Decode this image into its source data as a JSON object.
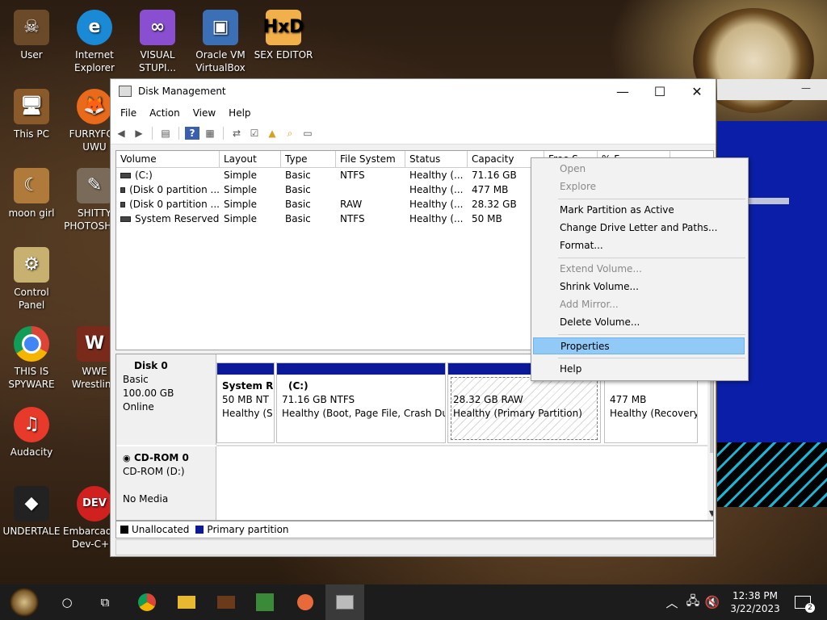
{
  "desktop": {
    "icons": [
      {
        "label": "User",
        "icon": "user-skull-icon",
        "color": "#6b4a2a"
      },
      {
        "label": "Internet Explorer",
        "icon": "edge-icon",
        "color": "#1b8ad6"
      },
      {
        "label": "VISUAL STUPI...",
        "icon": "visual-studio-icon",
        "color": "#8a4fd0"
      },
      {
        "label": "Oracle VM VirtualBox",
        "icon": "virtualbox-icon",
        "color": "#3b6fb6"
      },
      {
        "label": "SEX EDITOR",
        "icon": "hex-editor-icon",
        "color": "#f2b04a"
      },
      {
        "label": "This PC",
        "icon": "this-pc-icon",
        "color": "#8a5a2a"
      },
      {
        "label": "FURRYFOX UWU",
        "icon": "firefox-icon",
        "color": "#e86a1a"
      },
      {
        "label": "moon girl",
        "icon": "moon-girl-icon",
        "color": "#b07a3a"
      },
      {
        "label": "SHITTY PHOTOSHOP",
        "icon": "gimp-icon",
        "color": "#7a6a5a"
      },
      {
        "label": "Control Panel",
        "icon": "control-panel-icon",
        "color": "#c8b070"
      },
      {
        "label": "THIS IS SPYWARE",
        "icon": "chrome-icon",
        "color": "#2a8a3a"
      },
      {
        "label": "WWE Wrestling",
        "icon": "wwe-icon",
        "color": "#7a2a1a"
      },
      {
        "label": "Audacity",
        "icon": "audacity-icon",
        "color": "#e83a2a"
      },
      {
        "label": "UNDERTALE",
        "icon": "unity-icon",
        "color": "#222222"
      },
      {
        "label": "Embarcadero Dev-C++",
        "icon": "devcpp-icon",
        "color": "#d02020"
      }
    ]
  },
  "window": {
    "title": "Disk Management",
    "controls": {
      "minimize": "—",
      "maximize": "☐",
      "close": "✕"
    },
    "menu": [
      "File",
      "Action",
      "View",
      "Help"
    ]
  },
  "volumes": {
    "columns": [
      "Volume",
      "Layout",
      "Type",
      "File System",
      "Status",
      "Capacity",
      "Free S...",
      "% F..."
    ],
    "rows": [
      {
        "volume": "(C:)",
        "layout": "Simple",
        "type": "Basic",
        "fs": "NTFS",
        "status": "Healthy (...",
        "capacity": "71.16 GB"
      },
      {
        "volume": "(Disk 0 partition ...",
        "layout": "Simple",
        "type": "Basic",
        "fs": "",
        "status": "Healthy (...",
        "capacity": "477 MB"
      },
      {
        "volume": "(Disk 0 partition ...",
        "layout": "Simple",
        "type": "Basic",
        "fs": "RAW",
        "status": "Healthy (...",
        "capacity": "28.32 GB"
      },
      {
        "volume": "System Reserved",
        "layout": "Simple",
        "type": "Basic",
        "fs": "NTFS",
        "status": "Healthy (...",
        "capacity": "50 MB"
      }
    ]
  },
  "disks": {
    "disk0": {
      "name": "Disk 0",
      "type": "Basic",
      "size": "100.00 GB",
      "state": "Online",
      "partitions": [
        {
          "title": "System Re",
          "line1": "50 MB NT",
          "line2": "Healthy (S"
        },
        {
          "title": "(C:)",
          "line1": "71.16 GB NTFS",
          "line2": "Healthy (Boot, Page File, Crash Dun"
        },
        {
          "title": "",
          "line1": "28.32 GB RAW",
          "line2": "Healthy (Primary Partition)"
        },
        {
          "title": "",
          "line1": "477 MB",
          "line2": "Healthy (Recovery"
        }
      ]
    },
    "cdrom": {
      "name": "CD-ROM 0",
      "drive": "CD-ROM (D:)",
      "media": "No Media"
    }
  },
  "legend": {
    "unallocated": "Unallocated",
    "unallocated_color": "#000000",
    "primary": "Primary partition",
    "primary_color": "#0c1a9a"
  },
  "context_menu": {
    "items": [
      {
        "label": "Open",
        "enabled": false
      },
      {
        "label": "Explore",
        "enabled": false
      },
      {
        "label": "Mark Partition as Active",
        "enabled": true
      },
      {
        "label": "Change Drive Letter and Paths...",
        "enabled": true
      },
      {
        "label": "Format...",
        "enabled": true
      },
      {
        "label": "Extend Volume...",
        "enabled": false
      },
      {
        "label": "Shrink Volume...",
        "enabled": true
      },
      {
        "label": "Add Mirror...",
        "enabled": false
      },
      {
        "label": "Delete Volume...",
        "enabled": true
      },
      {
        "label": "Properties",
        "enabled": true,
        "highlighted": true
      },
      {
        "label": "Help",
        "enabled": true
      }
    ]
  },
  "taskbar": {
    "time": "12:38 PM",
    "date": "3/22/2023",
    "notification_count": "2"
  }
}
